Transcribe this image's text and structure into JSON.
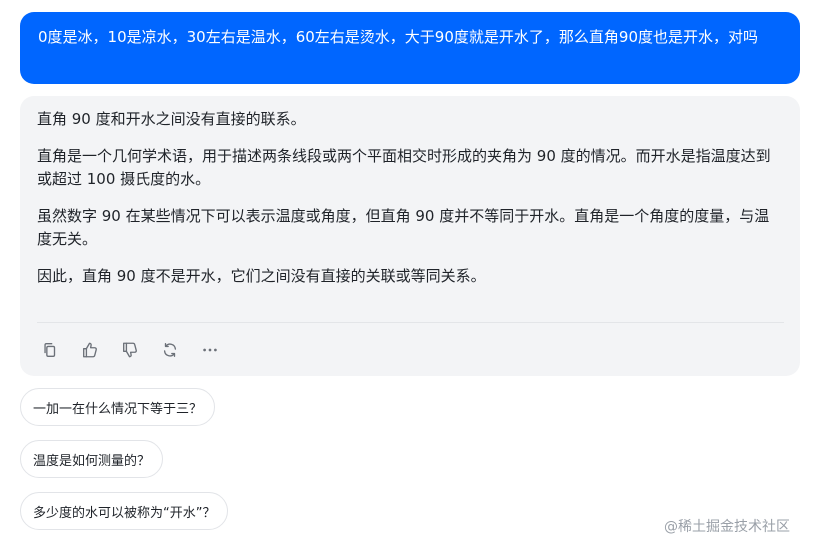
{
  "user_message": {
    "text": "0度是冰，10是凉水，30左右是温水，60左右是烫水，大于90度就是开水了，那么直角90度也是开水，对吗"
  },
  "assistant_message": {
    "paragraphs": [
      "直角 90 度和开水之间没有直接的联系。",
      "直角是一个几何学术语，用于描述两条线段或两个平面相交时形成的夹角为 90 度的情况。而开水是指温度达到或超过 100 摄氏度的水。",
      "虽然数字 90 在某些情况下可以表示温度或角度，但直角 90 度并不等同于开水。直角是一个角度的度量，与温度无关。",
      "因此，直角 90 度不是开水，它们之间没有直接的关联或等同关系。"
    ],
    "actions": [
      {
        "icon": "copy-icon"
      },
      {
        "icon": "thumbs-up-icon"
      },
      {
        "icon": "thumbs-down-icon"
      },
      {
        "icon": "regenerate-icon"
      },
      {
        "icon": "more-icon"
      }
    ]
  },
  "suggestions": [
    "一加一在什么情况下等于三？",
    "温度是如何测量的？",
    "多少度的水可以被称为“开水”？"
  ],
  "watermark": "@稀土掘金技术社区",
  "colors": {
    "user_bubble": "#0066ff",
    "assistant_bg": "#f3f4f6",
    "text": "#1f2329",
    "icon": "#6b7078"
  }
}
